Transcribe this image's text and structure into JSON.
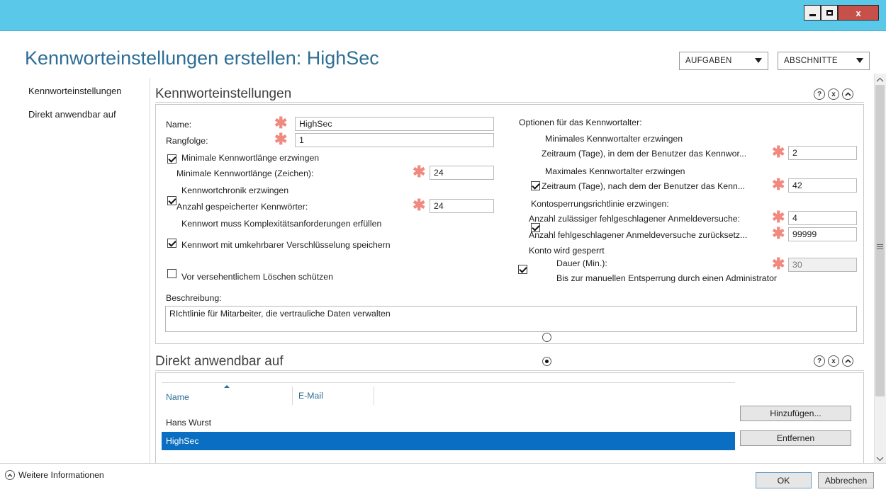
{
  "window": {
    "controls": {
      "minimize": "–",
      "maximize": "□",
      "close": "x"
    }
  },
  "header": {
    "title": "Kennworteinstellungen erstellen: HighSec",
    "tasks_label": "AUFGABEN",
    "sections_label": "ABSCHNITTE"
  },
  "nav": {
    "items": [
      "Kennworteinstellungen",
      "Direkt anwendbar auf"
    ]
  },
  "password_section": {
    "title": "Kennworteinstellungen",
    "icons": {
      "help": "?",
      "close": "x",
      "collapse": "^"
    },
    "name_label": "Name:",
    "name_value": "HighSec",
    "precedence_label": "Rangfolge:",
    "precedence_value": "1",
    "min_length_checkbox": "Minimale Kennwortlänge erzwingen",
    "min_length_checked": true,
    "min_length_label": "Minimale Kennwortlänge (Zeichen):",
    "min_length_value": "24",
    "history_checkbox": "Kennwortchronik erzwingen",
    "history_checked": true,
    "history_label": "Anzahl gespeicherter Kennwörter:",
    "history_value": "24",
    "complexity_checkbox": "Kennwort muss Komplexitätsanforderungen erfüllen",
    "complexity_checked": true,
    "reversible_checkbox": "Kennwort mit umkehrbarer Verschlüsselung speichern",
    "reversible_checked": false,
    "protect_checkbox": "Vor versehentlichem Löschen schützen",
    "protect_checked": true,
    "description_label": "Beschreibung:",
    "description_value": "RIchtlinie für Mitarbeiter, die vertrauliche Daten verwalten",
    "age_options_label": "Optionen für das Kennwortalter:",
    "min_age_checkbox": "Minimales Kennwortalter erzwingen",
    "min_age_checked": true,
    "min_age_label": "Zeitraum (Tage), in dem der Benutzer das Kennwor...",
    "min_age_value": "2",
    "max_age_checkbox": "Maximales Kennwortalter erzwingen",
    "max_age_checked": true,
    "max_age_label": "Zeitraum (Tage), nach dem der Benutzer das Kenn...",
    "max_age_value": "42",
    "lockout_checkbox": "Kontosperrungsrichtlinie erzwingen:",
    "lockout_checked": true,
    "failed_attempts_label": "Anzahl zulässiger fehlgeschlagener Anmeldeversuche:",
    "failed_attempts_value": "4",
    "reset_label": "Anzahl fehlgeschlagener Anmeldeversuche zurücksetz...",
    "reset_value": "99999",
    "locked_label": "Konto wird gesperrt",
    "duration_radio": "Dauer (Min.):",
    "duration_value": "30",
    "manual_radio": "Bis zur manuellen Entsperrung durch einen Administrator",
    "selected_radio": "manual"
  },
  "applies_section": {
    "title": "Direkt anwendbar auf",
    "icons": {
      "help": "?",
      "close": "x",
      "collapse": "^"
    },
    "columns": [
      "Name",
      "E-Mail"
    ],
    "rows": [
      {
        "name": "Hans Wurst",
        "email": "",
        "selected": false
      },
      {
        "name": "HighSec",
        "email": "",
        "selected": true
      }
    ],
    "add_button": "Hinzufügen...",
    "remove_button": "Entfernen"
  },
  "footer": {
    "more_info": "Weitere Informationen",
    "ok": "OK",
    "cancel": "Abbrechen"
  },
  "colors": {
    "titlebar": "#5ac8e8",
    "accent": "#2d6e96",
    "selection": "#0a6fc2",
    "required": "#f08a80"
  }
}
